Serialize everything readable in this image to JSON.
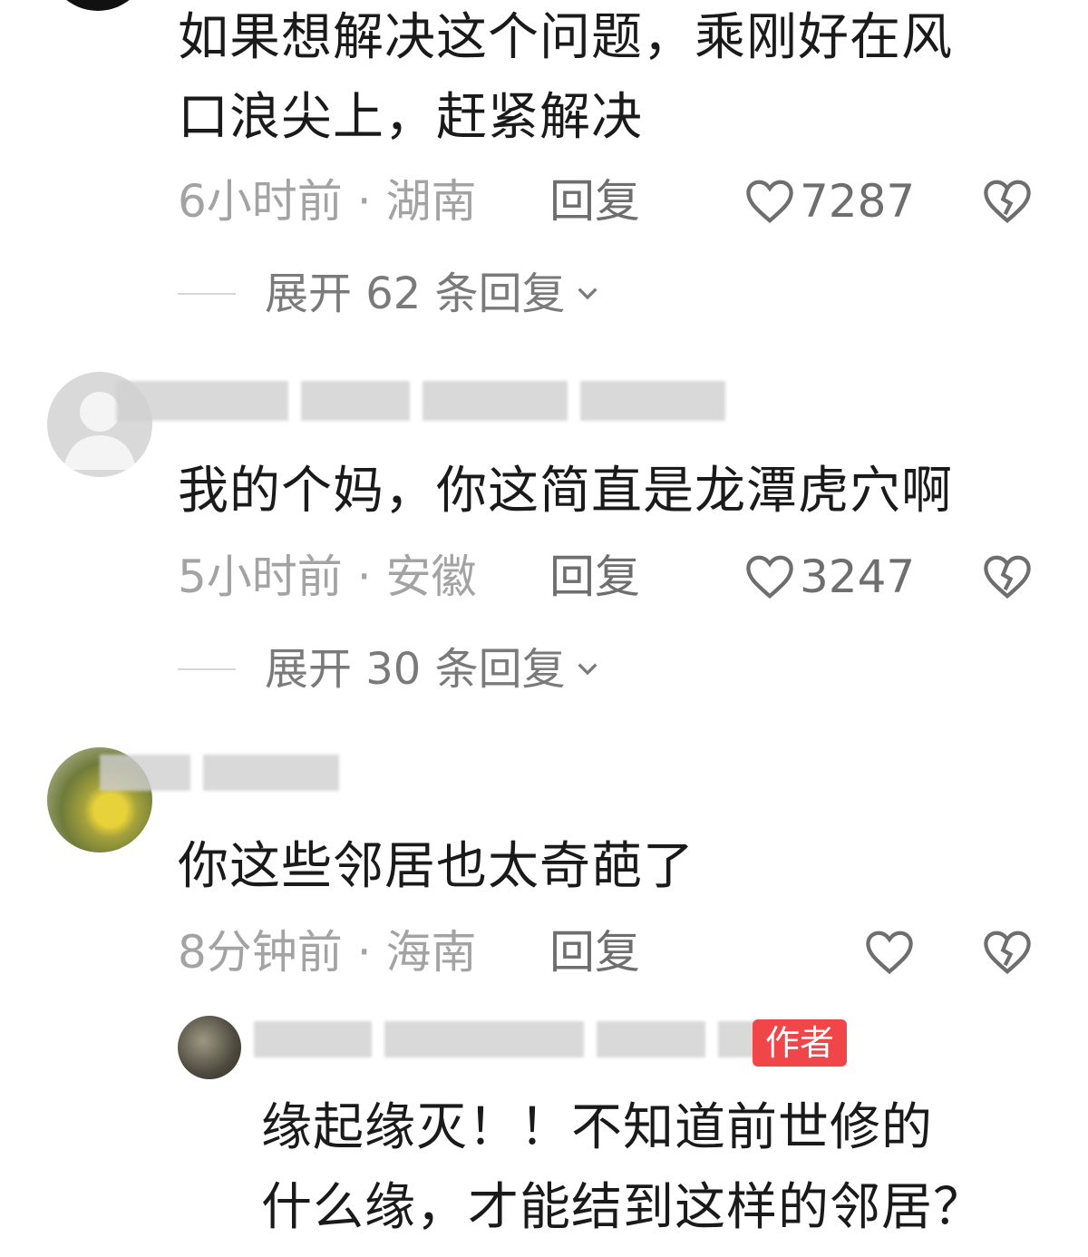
{
  "comments": [
    {
      "text_line1": "如果想解决这个问题，乘刚好在风",
      "text_line2": "口浪尖上，赶紧解决",
      "meta": "6小时前 · 湖南",
      "reply_label": "回复",
      "likes": "7287",
      "expand_label": "展开 62 条回复"
    },
    {
      "text": "我的个妈，你这简直是龙潭虎穴啊",
      "meta": "5小时前 · 安徽",
      "reply_label": "回复",
      "likes": "3247",
      "expand_label": "展开 30 条回复"
    },
    {
      "text": "你这些邻居也太奇葩了",
      "meta": "8分钟前 · 海南",
      "reply_label": "回复",
      "likes": ""
    }
  ],
  "author_reply": {
    "badge": "作者",
    "text_line1": "缘起缘灭！！不知道前世修的",
    "text_line2": "什么缘，才能结到这样的邻居？"
  },
  "icons": {
    "like": "heart-outline-icon",
    "dislike": "broken-heart-icon",
    "expand": "chevron-down-icon",
    "default_avatar": "default-user-avatar"
  },
  "colors": {
    "text": "#1a1a1a",
    "meta": "#a3a3a3",
    "author_badge": "#f0464a"
  }
}
